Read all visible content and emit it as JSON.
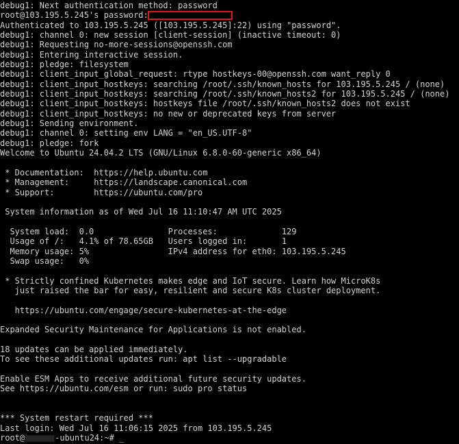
{
  "terminal": {
    "lines": [
      "debug1: Next authentication method: password",
      "root@103.195.5.245's password: ",
      "Authenticated to 103.195.5.245 ([103.195.5.245]:22) using \"password\".",
      "debug1: channel 0: new session [client-session] (inactive timeout: 0)",
      "debug1: Requesting no-more-sessions@openssh.com",
      "debug1: Entering interactive session.",
      "debug1: pledge: filesystem",
      "debug1: client_input_global_request: rtype hostkeys-00@openssh.com want_reply 0",
      "debug1: client_input_hostkeys: searching /root/.ssh/known_hosts for 103.195.5.245 / (none)",
      "debug1: client_input_hostkeys: searching /root/.ssh/known_hosts2 for 103.195.5.245 / (none)",
      "debug1: client_input_hostkeys: hostkeys file /root/.ssh/known_hosts2 does not exist",
      "debug1: client_input_hostkeys: no new or deprecated keys from server",
      "debug1: Sending environment.",
      "debug1: channel 0: setting env LANG = \"en_US.UTF-8\"",
      "debug1: pledge: fork",
      "Welcome to Ubuntu 24.04.2 LTS (GNU/Linux 6.8.0-60-generic x86_64)",
      "",
      " * Documentation:  https://help.ubuntu.com",
      " * Management:     https://landscape.canonical.com",
      " * Support:        https://ubuntu.com/pro",
      "",
      " System information as of Wed Jul 16 11:10:47 AM UTC 2025",
      "",
      "  System load:  0.0               Processes:             129",
      "  Usage of /:   4.1% of 78.65GB   Users logged in:       1",
      "  Memory usage: 5%                IPv4 address for eth0: 103.195.5.245",
      "  Swap usage:   0%",
      "",
      " * Strictly confined Kubernetes makes edge and IoT secure. Learn how MicroK8s",
      "   just raised the bar for easy, resilient and secure K8s cluster deployment.",
      "",
      "   https://ubuntu.com/engage/secure-kubernetes-at-the-edge",
      "",
      "Expanded Security Maintenance for Applications is not enabled.",
      "",
      "18 updates can be applied immediately.",
      "To see these additional updates run: apt list --upgradable",
      "",
      "Enable ESM Apps to receive additional future security updates.",
      "See https://ubuntu.com/esm or run: sudo pro status",
      "",
      "",
      "*** System restart required ***",
      "Last login: Wed Jul 16 11:06:15 2025 from 103.195.5.245"
    ],
    "prompt_prefix": "root@",
    "prompt_suffix": "-ubuntu24:~# ",
    "cursor": "_",
    "colors": {
      "background": "#000000",
      "foreground": "#d2d2d2",
      "redaction_box": "#e3161c"
    }
  }
}
